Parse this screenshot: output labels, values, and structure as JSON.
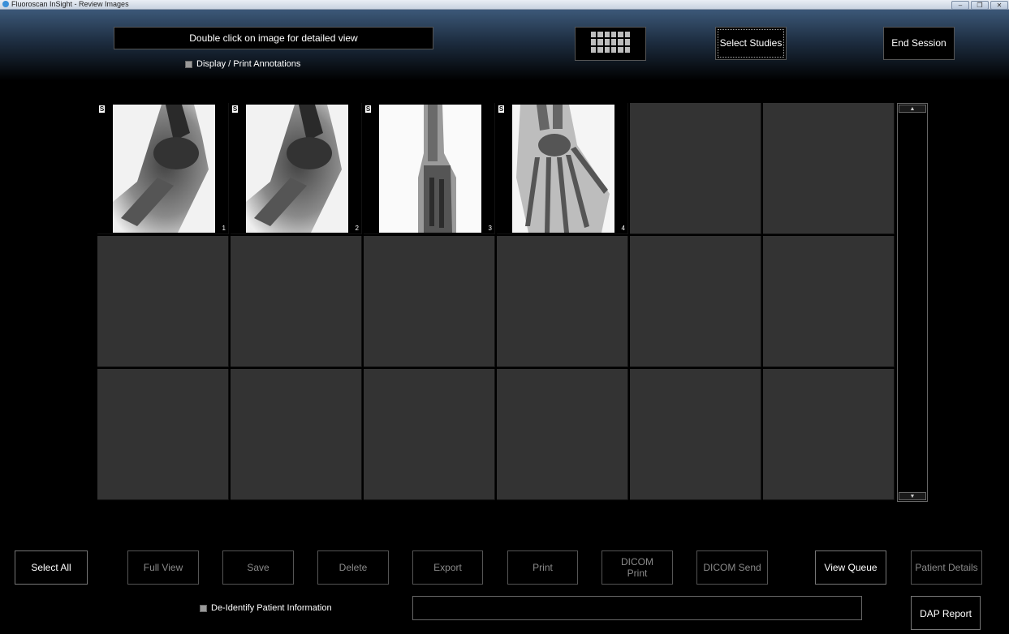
{
  "window": {
    "title": "Fluoroscan InSight - Review Images",
    "controls": [
      "–",
      "❐",
      "✕"
    ]
  },
  "header": {
    "message": "Double click on image for detailed view",
    "annotations_label": "Display / Print Annotations",
    "select_studies": "Select Studies",
    "end_session": "End Session"
  },
  "thumbnails": [
    {
      "badge": "S",
      "number": "1"
    },
    {
      "badge": "S",
      "number": "2"
    },
    {
      "badge": "S",
      "number": "3"
    },
    {
      "badge": "S",
      "number": "4"
    }
  ],
  "scrollbar": {
    "up": "▲",
    "down": "▼"
  },
  "toolbar": {
    "select_all": "Select All",
    "full_view": "Full View",
    "save": "Save",
    "delete": "Delete",
    "export": "Export",
    "print": "Print",
    "dicom_print": "DICOM Print",
    "dicom_send": "DICOM Send",
    "view_queue": "View Queue",
    "patient_details": "Patient Details"
  },
  "footer": {
    "deidentify_label": "De-Identify Patient Information",
    "dap_report": "DAP Report"
  }
}
